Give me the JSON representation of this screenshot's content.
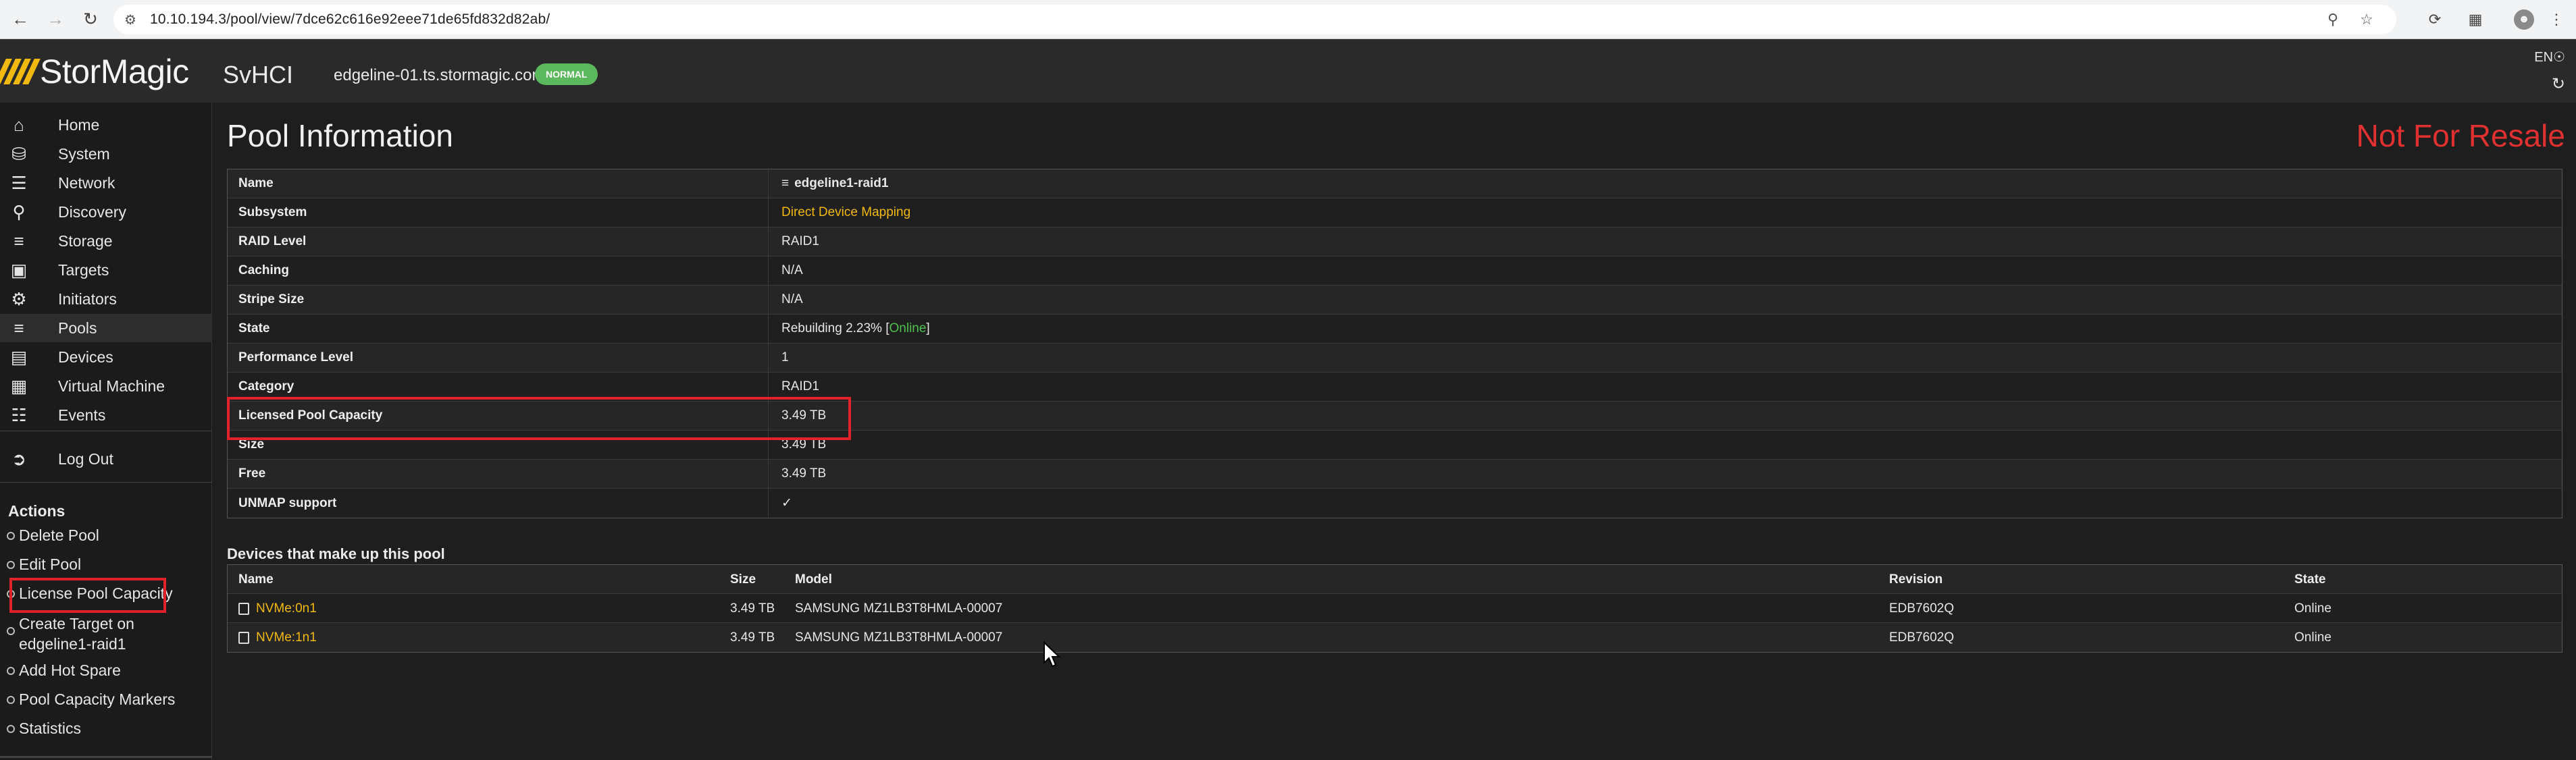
{
  "browser": {
    "url": "10.10.194.3/pool/view/7dce62c616e92eee71de65fd832d82ab/"
  },
  "header": {
    "logo_text": "StorMagic",
    "product": "SvHCI",
    "host": "edgeline-01.ts.stormagic.com",
    "status": "NORMAL",
    "language": "EN"
  },
  "sidebar": {
    "items": [
      {
        "label": "Home",
        "icon": "home-icon"
      },
      {
        "label": "System",
        "icon": "system-icon"
      },
      {
        "label": "Network",
        "icon": "network-icon"
      },
      {
        "label": "Discovery",
        "icon": "discovery-icon"
      },
      {
        "label": "Storage",
        "icon": "storage-icon"
      },
      {
        "label": "Targets",
        "icon": "targets-icon"
      },
      {
        "label": "Initiators",
        "icon": "initiators-icon"
      },
      {
        "label": "Pools",
        "icon": "pools-icon"
      },
      {
        "label": "Devices",
        "icon": "devices-icon"
      },
      {
        "label": "Virtual Machine",
        "icon": "virtual-machine-icon"
      },
      {
        "label": "Events",
        "icon": "events-icon"
      }
    ],
    "logout": "Log Out",
    "actions_title": "Actions",
    "actions": [
      "Delete Pool",
      "Edit Pool",
      "License Pool Capacity",
      "Create Target on edgeline1-raid1",
      "Add Hot Spare",
      "Pool Capacity Markers",
      "Statistics"
    ]
  },
  "main": {
    "title": "Pool Information",
    "not_for_resale": "Not For Resale",
    "info": {
      "name_key": "Name",
      "name_val": "edgeline1-raid1",
      "subsystem_key": "Subsystem",
      "subsystem_val": "Direct Device Mapping",
      "raid_key": "RAID Level",
      "raid_val": "RAID1",
      "caching_key": "Caching",
      "caching_val": "N/A",
      "stripe_key": "Stripe Size",
      "stripe_val": "N/A",
      "state_key": "State",
      "state_prefix": "Rebuilding 2.23% [",
      "state_online": "Online",
      "state_suffix": "]",
      "perf_key": "Performance Level",
      "perf_val": "1",
      "category_key": "Category",
      "category_val": "RAID1",
      "licensed_key": "Licensed Pool Capacity",
      "licensed_val": "3.49 TB",
      "size_key": "Size",
      "size_val": "3.49 TB",
      "free_key": "Free",
      "free_val": "3.49 TB",
      "unmap_key": "UNMAP support",
      "unmap_val": "✓"
    },
    "devices_title": "Devices that make up this pool",
    "devices_headers": {
      "name": "Name",
      "size": "Size",
      "model": "Model",
      "revision": "Revision",
      "state": "State"
    },
    "devices": [
      {
        "name": "NVMe:0n1",
        "size": "3.49 TB",
        "model": "SAMSUNG MZ1LB3T8HMLA-00007",
        "revision": "EDB7602Q",
        "state": "Online"
      },
      {
        "name": "NVMe:1n1",
        "size": "3.49 TB",
        "model": "SAMSUNG MZ1LB3T8HMLA-00007",
        "revision": "EDB7602Q",
        "state": "Online"
      }
    ]
  }
}
